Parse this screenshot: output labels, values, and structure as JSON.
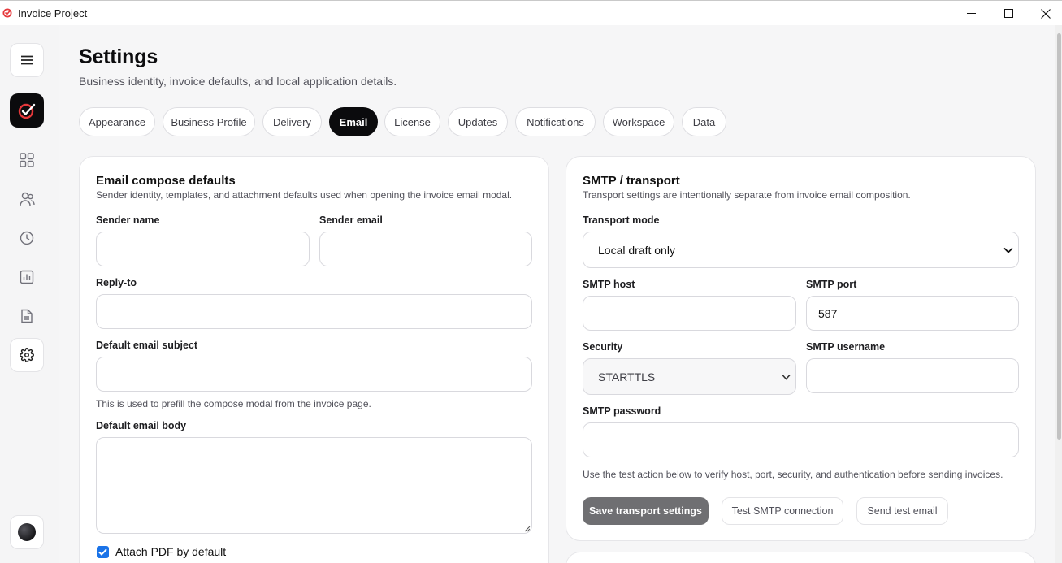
{
  "window": {
    "title": "Invoice Project"
  },
  "sidebar": {
    "items": [
      {
        "name": "menu",
        "icon": "hamburger-icon"
      },
      {
        "name": "brand",
        "icon": "brand-logo-icon"
      },
      {
        "name": "dashboard",
        "icon": "grid-icon"
      },
      {
        "name": "clients",
        "icon": "users-icon"
      },
      {
        "name": "history",
        "icon": "clock-icon"
      },
      {
        "name": "reports",
        "icon": "chart-icon"
      },
      {
        "name": "invoices",
        "icon": "document-icon"
      },
      {
        "name": "settings",
        "icon": "gear-icon",
        "active": true
      }
    ]
  },
  "page": {
    "title": "Settings",
    "subtitle": "Business identity, invoice defaults, and local application details."
  },
  "tabs": [
    {
      "label": "Appearance"
    },
    {
      "label": "Business Profile"
    },
    {
      "label": "Delivery"
    },
    {
      "label": "Email",
      "active": true
    },
    {
      "label": "License"
    },
    {
      "label": "Updates"
    },
    {
      "label": "Notifications"
    },
    {
      "label": "Workspace"
    },
    {
      "label": "Data"
    }
  ],
  "email_compose": {
    "title": "Email compose defaults",
    "description": "Sender identity, templates, and attachment defaults used when opening the invoice email modal.",
    "sender_name_label": "Sender name",
    "sender_name_value": "",
    "sender_email_label": "Sender email",
    "sender_email_value": "",
    "reply_to_label": "Reply-to",
    "reply_to_value": "",
    "subject_label": "Default email subject",
    "subject_value": "",
    "subject_hint": "This is used to prefill the compose modal from the invoice page.",
    "body_label": "Default email body",
    "body_value": "",
    "attach_pdf_label": "Attach PDF by default",
    "attach_pdf_checked": true
  },
  "smtp": {
    "title": "SMTP / transport",
    "description": "Transport settings are intentionally separate from invoice email composition.",
    "transport_mode_label": "Transport mode",
    "transport_mode_value": "Local draft only",
    "host_label": "SMTP host",
    "host_value": "",
    "port_label": "SMTP port",
    "port_value": "587",
    "security_label": "Security",
    "security_value": "STARTTLS",
    "username_label": "SMTP username",
    "username_value": "",
    "password_label": "SMTP password",
    "password_value": "",
    "hint": "Use the test action below to verify host, port, security, and authentication before sending invoices.",
    "save_button": "Save transport settings",
    "test_button": "Test SMTP connection",
    "send_test_button": "Send test email"
  },
  "colors": {
    "accent": "#0b0b0d",
    "checkbox": "#1a73e8",
    "brand_red": "#e5383b"
  }
}
